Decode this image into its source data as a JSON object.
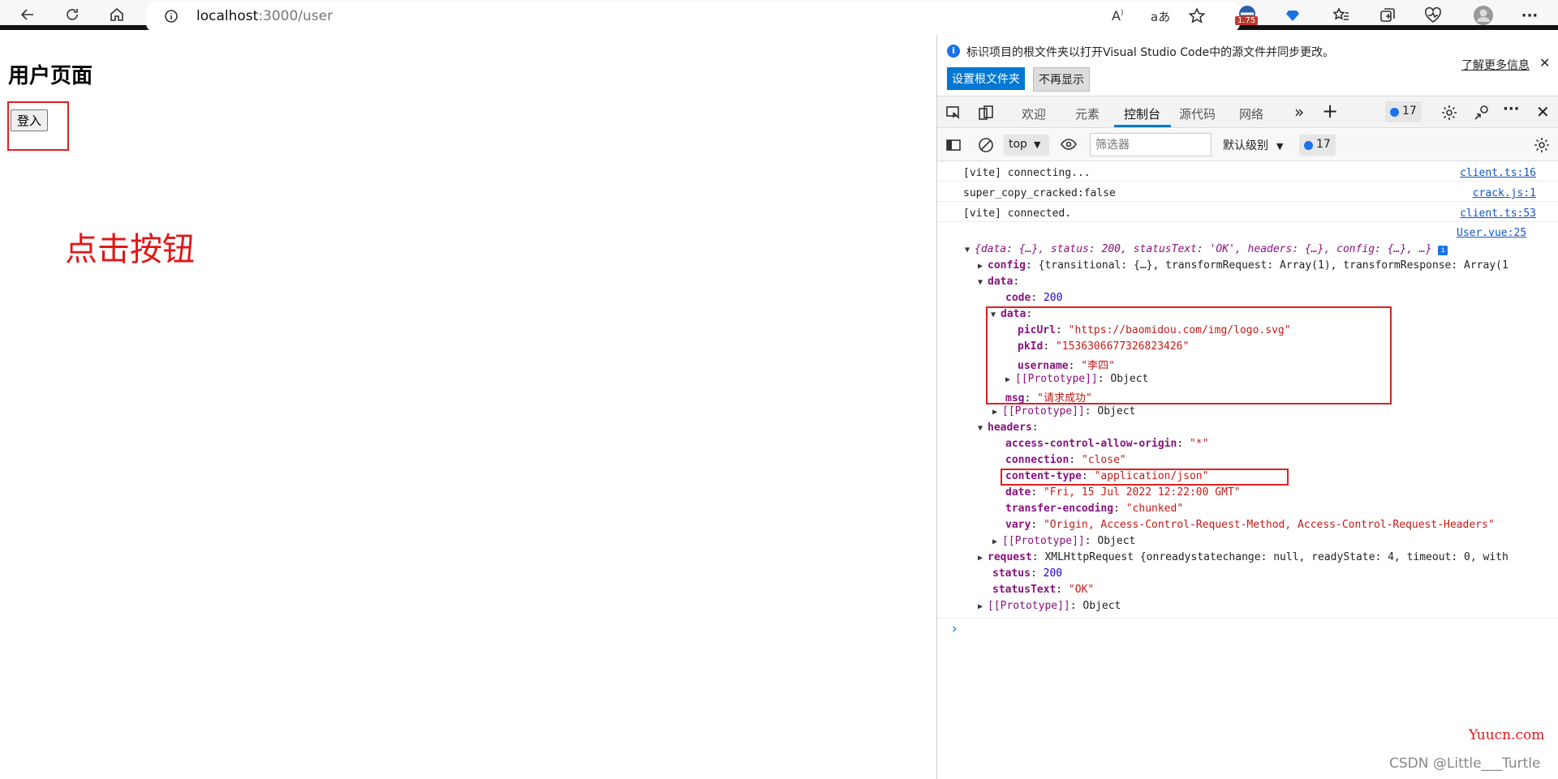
{
  "browser": {
    "url_host": "localhost",
    "url_path": ":3000/user",
    "extension_badge": "1.75"
  },
  "page": {
    "title": "用户页面",
    "login_button": "登入",
    "annotation": "点击按钮"
  },
  "devtools": {
    "infobar": {
      "message": "标识项目的根文件夹以打开Visual Studio Code中的源文件并同步更改。",
      "set_root_button": "设置根文件夹",
      "dont_show_button": "不再显示",
      "learn_more": "了解更多信息"
    },
    "tabs": [
      "欢迎",
      "元素",
      "控制台",
      "源代码",
      "网络"
    ],
    "issues_count": "17",
    "console_toolbar": {
      "context": "top",
      "filter_placeholder": "筛选器",
      "level": "默认级别",
      "messages_count": "17"
    },
    "log": [
      {
        "msg": "[vite] connecting...",
        "src": "client.ts:16"
      },
      {
        "msg": "super_copy_cracked:false",
        "src": "crack.js:1"
      },
      {
        "msg": "[vite] connected.",
        "src": "client.ts:53"
      }
    ],
    "object_src": "User.vue:25",
    "object_summary": "{data: {…}, status: 200, statusText: 'OK', headers: {…}, config: {…}, …}",
    "config_line": {
      "key": "config",
      "value": "{transitional: {…}, transformRequest: Array(1), transformResponse: Array(1"
    },
    "data_key": "data",
    "code": {
      "key": "code",
      "value": "200"
    },
    "inner_data_key": "data",
    "picUrl": {
      "key": "picUrl",
      "value": "\"https://baomidou.com/img/logo.svg\""
    },
    "pkId": {
      "key": "pkId",
      "value": "\"1536306677326823426\""
    },
    "username": {
      "key": "username",
      "value": "\"李四\""
    },
    "prototype_key": "[[Prototype]]",
    "prototype_value": "Object",
    "msg": {
      "key": "msg",
      "value": "\"请求成功\""
    },
    "headers_key": "headers",
    "headers": [
      {
        "key": "access-control-allow-origin",
        "value": "\"*\""
      },
      {
        "key": "connection",
        "value": "\"close\""
      },
      {
        "key": "content-type",
        "value": "\"application/json\""
      },
      {
        "key": "date",
        "value": "\"Fri, 15 Jul 2022 12:22:00 GMT\""
      },
      {
        "key": "transfer-encoding",
        "value": "\"chunked\""
      },
      {
        "key": "vary",
        "value": "\"Origin, Access-Control-Request-Method, Access-Control-Request-Headers\""
      }
    ],
    "request": {
      "key": "request",
      "type": "XMLHttpRequest",
      "value": "{onreadystatechange: null, readyState: 4, timeout: 0, with"
    },
    "status": {
      "key": "status",
      "value": "200"
    },
    "statusText": {
      "key": "statusText",
      "value": "\"OK\""
    },
    "prompt": "›"
  },
  "watermark": {
    "site": "Yuucn.com",
    "credit": "CSDN @Little___Turtle"
  }
}
